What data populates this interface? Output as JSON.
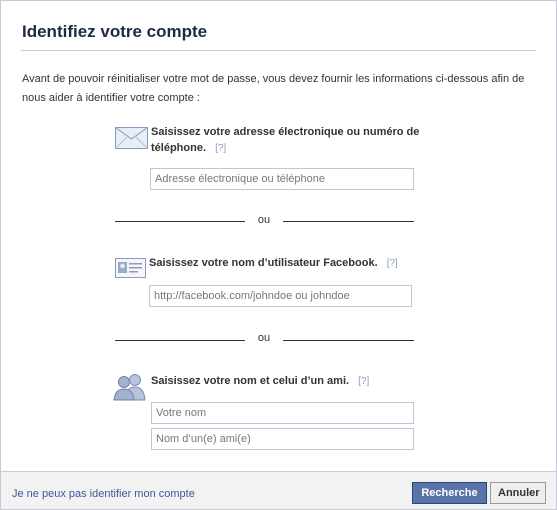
{
  "dialog": {
    "title": "Identifiez votre compte",
    "intro": "Avant de pouvoir réinitialiser votre mot de passe, vous devez fournir les informations ci-dessous afin de nous aider à identifier votre compte :"
  },
  "section_email": {
    "label_line1": "Saisissez votre adresse électronique ou numéro de",
    "label_line2": "téléphone.",
    "help": "[?]",
    "placeholder": "Adresse électronique ou téléphone"
  },
  "separator_1": "ou",
  "section_username": {
    "label": "Saisissez votre nom d’utilisateur Facebook.",
    "help": "[?]",
    "placeholder": "http://facebook.com/johndoe ou johndoe"
  },
  "separator_2": "ou",
  "section_names": {
    "label": "Saisissez votre nom et celui d’un ami.",
    "help": "[?]",
    "placeholder_name": "Votre nom",
    "placeholder_friend": "Nom d’un(e) ami(e)"
  },
  "footer": {
    "link": "Je ne peux pas identifier mon compte",
    "search_button": "Recherche",
    "cancel_button": "Annuler"
  },
  "colors": {
    "title": "#1c2a47",
    "link": "#3b5998",
    "primary_button": "#5b74a8"
  },
  "icons": [
    "envelope-icon",
    "id-card-icon",
    "friends-icon"
  ]
}
